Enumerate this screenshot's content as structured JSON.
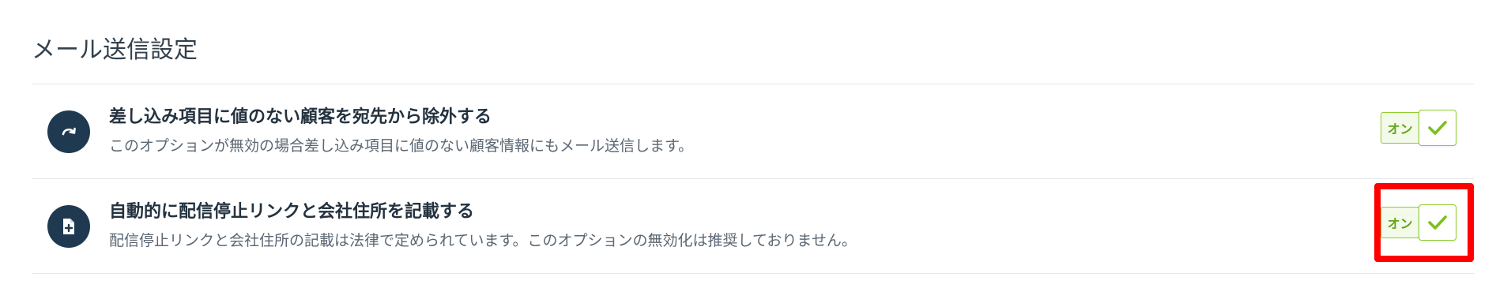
{
  "section": {
    "title": "メール送信設定"
  },
  "settings": [
    {
      "title": "差し込み項目に値のない顧客を宛先から除外する",
      "description": "このオプションが無効の場合差し込み項目に値のない顧客情報にもメール送信します。",
      "icon": "redo-arrow-icon",
      "toggle_label": "オン",
      "enabled": true
    },
    {
      "title": "自動的に配信停止リンクと会社住所を記載する",
      "description": "配信停止リンクと会社住所の記載は法律で定められています。このオプションの無効化は推奨しておりません。",
      "icon": "file-plus-icon",
      "toggle_label": "オン",
      "enabled": true
    }
  ],
  "colors": {
    "icon_bg": "#1f3a50",
    "toggle_green": "#8ccd2c",
    "highlight": "#ff0000"
  }
}
